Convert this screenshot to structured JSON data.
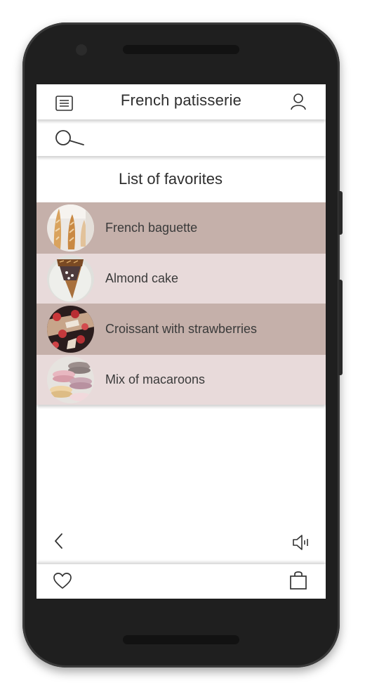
{
  "header": {
    "title": "French patisserie",
    "menu_icon": "menu-icon",
    "user_icon": "user-icon"
  },
  "search": {
    "icon": "search-icon"
  },
  "favorites": {
    "heading": "List of favorites",
    "items": [
      {
        "label": "French baguette",
        "thumb": "baguette"
      },
      {
        "label": "Almond cake",
        "thumb": "almond-cake"
      },
      {
        "label": "Croissant with strawberries",
        "thumb": "croissant"
      },
      {
        "label": "Mix of macaroons",
        "thumb": "macaroons"
      }
    ]
  },
  "navigation": {
    "back_icon": "chevron-left-icon",
    "volume_icon": "volume-icon",
    "favorites_icon": "heart-icon",
    "cart_icon": "shopping-bag-icon"
  },
  "colors": {
    "row_dark": "#c5b0aa",
    "row_light": "#e8dada",
    "text": "#2e2e2e",
    "device_body": "#1f1f1f"
  }
}
